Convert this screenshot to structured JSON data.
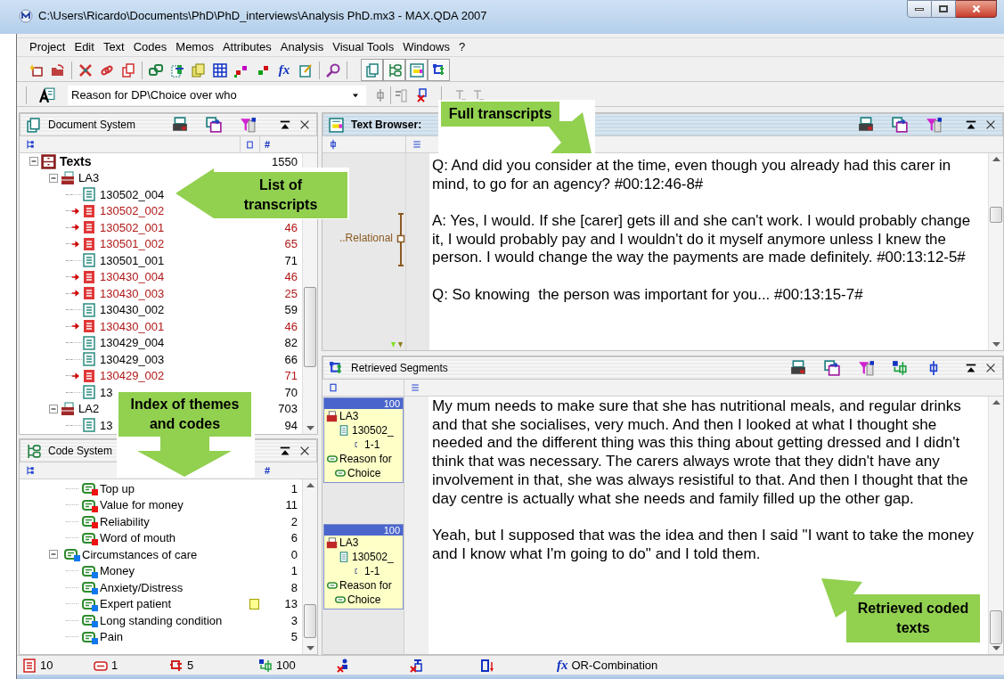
{
  "window": {
    "title": "C:\\Users\\Ricardo\\Documents\\PhD\\PhD_interviews\\Analysis PhD.mx3 - MAX.QDA 2007"
  },
  "menu": [
    "Project",
    "Edit",
    "Text",
    "Codes",
    "Memos",
    "Attributes",
    "Analysis",
    "Visual Tools",
    "Windows",
    "?"
  ],
  "toolbar": {
    "formula_button": "fx",
    "view_toggles": [
      {
        "selected": true
      },
      {
        "selected": true
      },
      {
        "selected": true
      },
      {
        "selected": true
      }
    ]
  },
  "code_combo": {
    "value": "Reason for DP\\Choice over who"
  },
  "document_system": {
    "title": "Document System",
    "active": false,
    "count_column": "#",
    "tree": [
      {
        "label": "Texts",
        "kind": "root",
        "count": "1550",
        "expanded": true,
        "children": [
          {
            "label": "LA3",
            "kind": "set",
            "expanded": true,
            "children": [
              {
                "label": "130502_004",
                "kind": "doc",
                "activated": false
              },
              {
                "label": "130502_002",
                "kind": "doc",
                "activated": true
              },
              {
                "label": "130502_001",
                "kind": "doc",
                "activated": true,
                "count": "46"
              },
              {
                "label": "130501_002",
                "kind": "doc",
                "activated": true,
                "count": "65"
              },
              {
                "label": "130501_001",
                "kind": "doc",
                "activated": false,
                "count": "71"
              },
              {
                "label": "130430_004",
                "kind": "doc",
                "activated": true,
                "count": "46"
              },
              {
                "label": "130430_003",
                "kind": "doc",
                "activated": true,
                "count": "25"
              },
              {
                "label": "130430_002",
                "kind": "doc",
                "activated": false,
                "count": "59"
              },
              {
                "label": "130430_001",
                "kind": "doc",
                "activated": true,
                "count": "46"
              },
              {
                "label": "130429_004",
                "kind": "doc",
                "activated": false,
                "count": "82"
              },
              {
                "label": "130429_003",
                "kind": "doc",
                "activated": false,
                "count": "66"
              },
              {
                "label": "130429_002",
                "kind": "doc",
                "activated": true,
                "count": "71"
              },
              {
                "label": "13",
                "kind": "doc",
                "activated": false,
                "count": "70"
              }
            ]
          },
          {
            "label": "LA2",
            "kind": "set",
            "count": "703",
            "expanded": true,
            "children": [
              {
                "label": "13",
                "kind": "doc",
                "activated": false,
                "count": "94"
              }
            ]
          }
        ]
      }
    ]
  },
  "code_system": {
    "title": "Code System",
    "active": false,
    "count_column": "#",
    "tree": [
      {
        "children": [
          {
            "label": "Top up",
            "count": "1",
            "color": "#ee1111"
          },
          {
            "label": "Value for money",
            "count": "11",
            "color": "#ee1111"
          },
          {
            "label": "Reliability",
            "count": "2",
            "color": "#ee1111"
          },
          {
            "label": "Word of mouth",
            "count": "6",
            "color": "#ee1111"
          }
        ]
      },
      {
        "label": "Circumstances of care",
        "count": "0",
        "color": "#1177ee",
        "expanded": true,
        "children": [
          {
            "label": "Money",
            "count": "1",
            "color": "#1177ee"
          },
          {
            "label": "Anxiety/Distress",
            "count": "8",
            "color": "#1177ee"
          },
          {
            "label": "Expert patient",
            "count": "13",
            "color": "#1177ee",
            "memo": true
          },
          {
            "label": "Long standing condition",
            "count": "3",
            "color": "#1177ee"
          },
          {
            "label": "Pain",
            "count": "5",
            "color": "#1177ee"
          }
        ]
      }
    ]
  },
  "text_browser": {
    "title": "Text Browser:",
    "active": true,
    "margin_code": "..Relational",
    "paragraphs": [
      "Q: And did you consider at the time, even though you already had this carer in mind, to go for an agency? #00:12:46-8#",
      "A: Yes, I would. If she [carer] gets ill and she can't work. I would probably change it, I would probably pay and I wouldn't do it myself anymore unless I knew the person. I would change the way the payments are made definitely. #00:13:12-5#",
      "Q: So knowing  the person was important for you... #00:13:15-7#"
    ]
  },
  "retrieved_segments": {
    "title": "Retrieved Segments",
    "active": false,
    "segments": [
      {
        "weight": "100",
        "group": "LA3",
        "document": "130502_",
        "position": "1-1",
        "code_parent": "Reason for",
        "code": "Choice"
      },
      {
        "weight": "100",
        "group": "LA3",
        "document": "130502_",
        "position": "1-1",
        "code_parent": "Reason for",
        "code": "Choice"
      }
    ],
    "paragraphs": [
      "My mum needs to make sure that she has nutritional meals, and regular drinks and that she socialises, very much. And then I looked at what I thought she needed and the different thing was this thing about getting dressed and I didn't think that was necessary. The carers always wrote that they didn't have any involvement in that, she was always resistiful to that. And then I thought that the day centre is actually what she needs and family filled up the other gap.",
      "Yeah, but I supposed that was the idea and then I said \"I want to take the money and I know what I'm going to do\" and I told them."
    ]
  },
  "status_bar": [
    {
      "kind": "documents",
      "text": "10"
    },
    {
      "kind": "codes",
      "text": "1"
    },
    {
      "kind": "segments",
      "text": "5"
    },
    {
      "kind": "retrieved",
      "text": "100"
    },
    {
      "kind": "reset-documents"
    },
    {
      "kind": "reset-codes"
    },
    {
      "kind": "sort"
    },
    {
      "kind": "combination",
      "prefix": "fx",
      "text": "OR-Combination"
    }
  ],
  "callouts": [
    "Full transcripts",
    "List of transcripts",
    "Index of themes and codes",
    "Retrieved coded texts"
  ]
}
